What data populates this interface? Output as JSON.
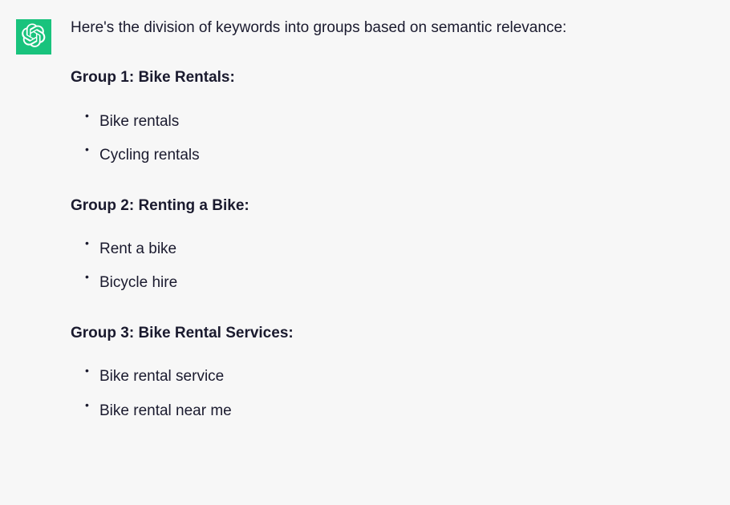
{
  "intro": "Here's the division of keywords into groups based on semantic relevance:",
  "groups": [
    {
      "title": "Group 1: Bike Rentals:",
      "items": [
        "Bike rentals",
        "Cycling rentals"
      ]
    },
    {
      "title": "Group 2: Renting a Bike:",
      "items": [
        "Rent a bike",
        "Bicycle hire"
      ]
    },
    {
      "title": "Group 3: Bike Rental Services:",
      "items": [
        "Bike rental service",
        "Bike rental near me"
      ]
    }
  ]
}
